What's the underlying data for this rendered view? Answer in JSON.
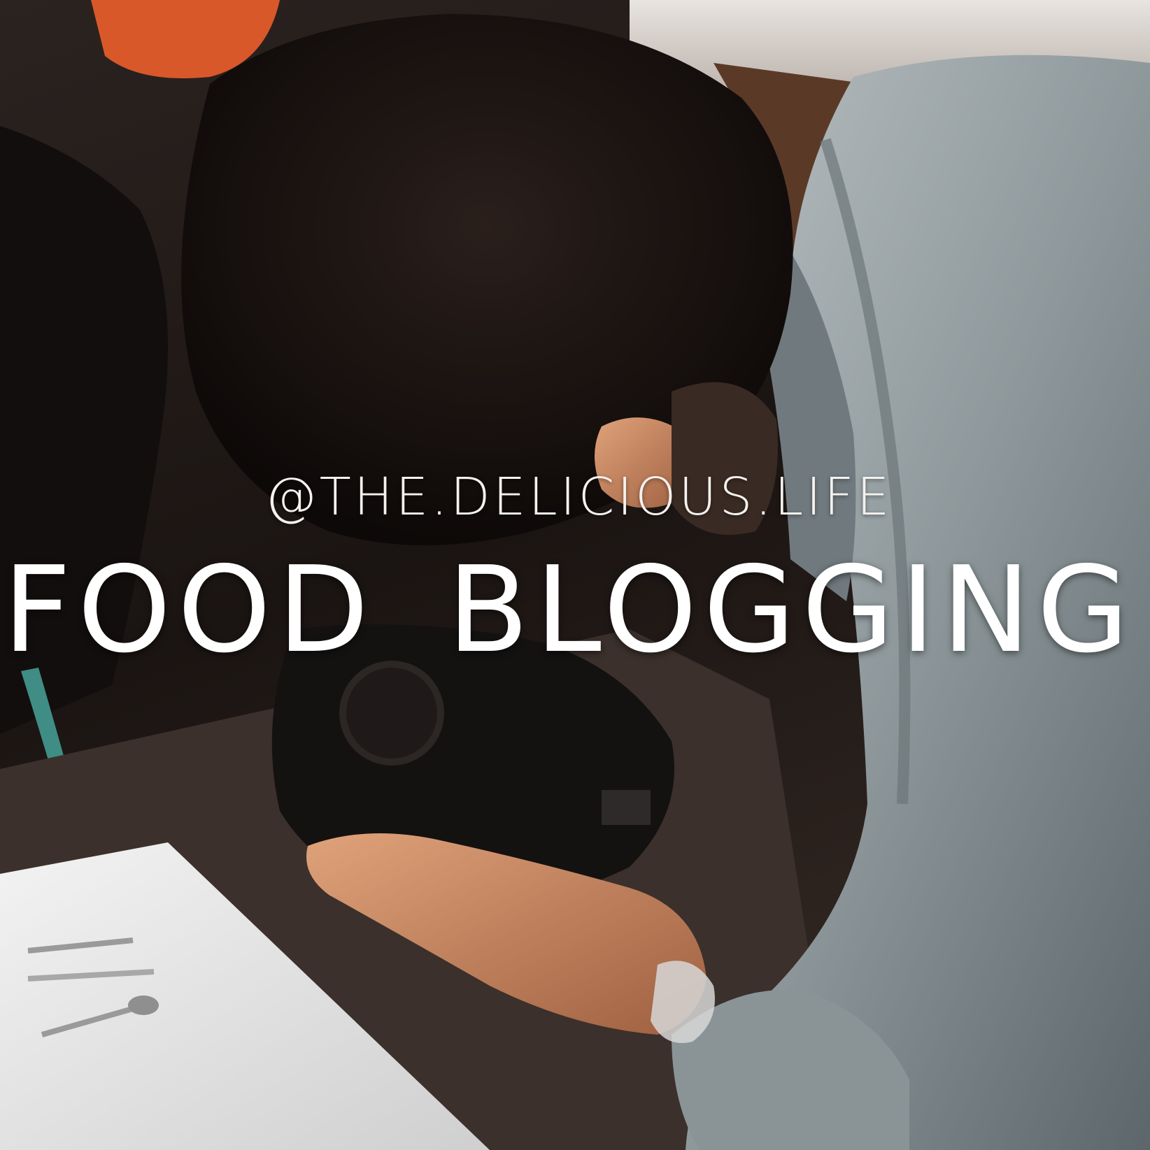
{
  "overlay": {
    "handle": "@THE.DELICIOUS.LIFE",
    "headline": "FOOD  BLOGGING"
  },
  "colors": {
    "text": "#ffffff",
    "jacket": "#9aa3a6",
    "hair": "#181211",
    "skin": "#c98a66",
    "table": "#eeeeee",
    "orange_accent": "#d8582a"
  }
}
